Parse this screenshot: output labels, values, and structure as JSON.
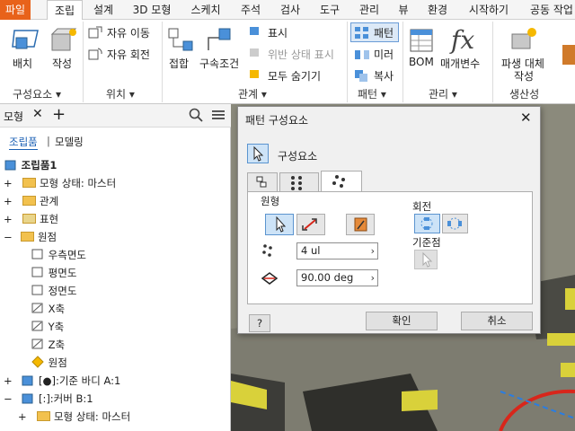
{
  "menubar": {
    "tabs": [
      "파일",
      "조립",
      "설계",
      "3D 모형",
      "스케치",
      "주석",
      "검사",
      "도구",
      "관리",
      "뷰",
      "환경",
      "시작하기",
      "공동 작업"
    ],
    "active": "조립"
  },
  "ribbon": {
    "groups": {
      "component": {
        "title": "구성요소 ▾",
        "place": "배치",
        "create": "작성"
      },
      "position": {
        "title": "위치 ▾",
        "move": "자유 이동",
        "rotate": "자유 회전"
      },
      "relation": {
        "title": "관계 ▾",
        "joint": "접합",
        "constrain": "구속조건",
        "show": "표시",
        "show_sick": "위반 상태 표시",
        "hide_all": "모두 숨기기"
      },
      "pattern": {
        "title": "패턴 ▾",
        "pattern": "패턴",
        "mirror": "미러",
        "copy": "복사"
      },
      "manage": {
        "title": "관리 ▾",
        "bom": "BOM",
        "params": "매개변수"
      },
      "productivity": {
        "title": "생산성",
        "substitute": "파생 대체",
        "create": "작성"
      }
    },
    "accent": "#e8621a"
  },
  "browser": {
    "title": "모형",
    "tabs": [
      "조립품",
      "모델링"
    ],
    "items": [
      {
        "label": "조립품1",
        "level": 0
      },
      {
        "label": "모형 상태: 마스터",
        "level": 1
      },
      {
        "label": "관계",
        "level": 1
      },
      {
        "label": "표현",
        "level": 1
      },
      {
        "label": "원점",
        "level": 1
      },
      {
        "label": "우측면도",
        "level": 2
      },
      {
        "label": "평면도",
        "level": 2
      },
      {
        "label": "정면도",
        "level": 2
      },
      {
        "label": "X축",
        "level": 2
      },
      {
        "label": "Y축",
        "level": 2
      },
      {
        "label": "Z축",
        "level": 2
      },
      {
        "label": "원점",
        "level": 2
      },
      {
        "label": "[●]:기준 바디 A:1",
        "level": 1
      },
      {
        "label": "[:]:커버 B:1",
        "level": 1
      },
      {
        "label": "모형 상태: 마스터",
        "level": 2
      }
    ]
  },
  "dialog": {
    "title": "패턴 구성요소",
    "component_label": "구성요소",
    "section_circular": "원형",
    "rotation_label": "회전",
    "datum_label": "기준점",
    "count_value": "4 ul",
    "angle_value": "90.00 deg",
    "ok": "확인",
    "cancel": "취소",
    "help": "?"
  }
}
